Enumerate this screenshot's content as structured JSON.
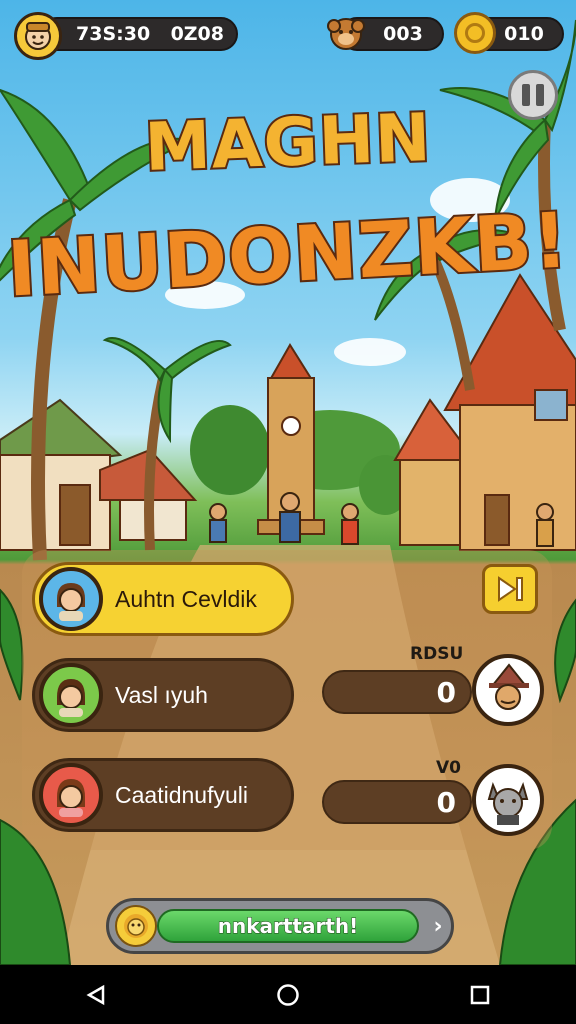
{
  "hud": {
    "time": "73S:30",
    "count_left": "0Z08",
    "creature_count": "003",
    "coin_count": "010",
    "player_icon": "player-face-icon",
    "creature_icon": "monkey-icon",
    "coin_icon": "coin-icon"
  },
  "title": {
    "line1": "MAGHN",
    "line2": "INUDONZKB!"
  },
  "players": [
    {
      "name": "Auhtn Cevldik",
      "highlight": true
    },
    {
      "name": "Vasl ıyuh",
      "highlight": false
    },
    {
      "name": "Caatidnufyuli",
      "highlight": false
    }
  ],
  "opponents": [
    {
      "label": "RDSU",
      "score": "0"
    },
    {
      "label": "V0",
      "score": "0"
    }
  ],
  "action_bar": {
    "label": "nnkarttarth!"
  },
  "colors": {
    "accent_yellow": "#f6cf2f",
    "title_orange": "#f08a24",
    "bar_green": "#3db84a",
    "panel_brown": "#5d3e24"
  }
}
